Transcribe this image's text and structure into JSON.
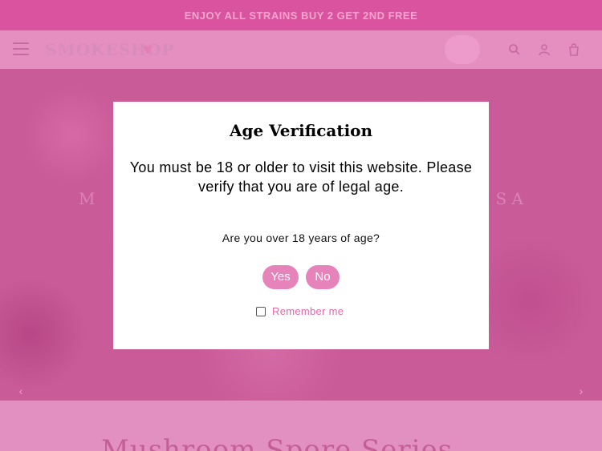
{
  "announcement": {
    "text": "ENJOY ALL STRAINS BUY 2 GET 2ND FREE"
  },
  "header": {
    "logo_text": "SMOKESHOP",
    "icons": {
      "menu": "menu-icon",
      "search": "search-icon",
      "account": "user-icon",
      "cart": "cart-icon"
    }
  },
  "hero": {
    "heading_left": "M",
    "heading_right": "S A"
  },
  "below": {
    "section_title": "Mushroom Spore Series"
  },
  "modal": {
    "title": "Age Verification",
    "message": "You must be 18 or older to visit this website. Please verify that you are of legal age.",
    "question": "Are you over 18 years of age?",
    "yes_label": "Yes",
    "no_label": "No",
    "remember_label": "Remember me"
  },
  "colors": {
    "accent": "#e583ba",
    "announcement_bg": "#d9539f",
    "header_bg": "#e58fc0",
    "remember_text": "#e06aa9"
  }
}
